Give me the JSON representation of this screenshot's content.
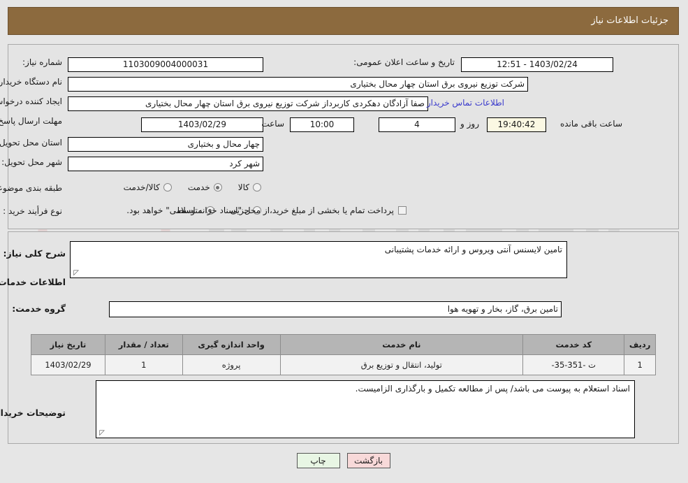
{
  "header": {
    "title": "جزئیات اطلاعات نیاز"
  },
  "colors": {
    "header_bg": "#8c6a3e",
    "page_bg": "#e6e6e6",
    "panel_bg": "#e4e4e4",
    "link": "#3b3bcc",
    "print_btn_bg": "#e8f6e4",
    "back_btn_bg": "#f8d9d9",
    "countdown_bg": "#fbf8e3"
  },
  "form": {
    "need_number_label": "شماره نیاز:",
    "need_number_value": "1103009004000031",
    "announce_datetime_label": "تاریخ و ساعت اعلان عمومی:",
    "announce_datetime_value": "1403/02/24 - 12:51",
    "buyer_org_label": "نام دستگاه خریدار:",
    "buyer_org_value": "شرکت توزیع نیروی برق استان چهار محال بختیاری",
    "creator_label": "ایجاد کننده درخواست:",
    "creator_value": "صفا آزادگان دهکردی کاربرداز شرکت توزیع نیروی برق استان چهار محال بختیاری",
    "buyer_contact_link": "اطلاعات تماس خریدار",
    "deadline_label": "مهلت ارسال پاسخ: تا تاریخ:",
    "deadline_date": "1403/02/29",
    "deadline_time_label": "ساعت",
    "deadline_time": "10:00",
    "remaining_days": "4",
    "remaining_days_label": "روز و",
    "remaining_clock": "19:40:42",
    "remaining_clock_label": "ساعت باقی مانده",
    "province_label": "استان محل تحویل:",
    "province_value": "چهار محال و بختیاری",
    "city_label": "شهر محل تحویل:",
    "city_value": "شهر کرد",
    "category_label": "طبقه بندی موضوعی:",
    "category_options": [
      {
        "label": "کالا",
        "selected": false
      },
      {
        "label": "خدمت",
        "selected": true
      },
      {
        "label": "کالا/خدمت",
        "selected": false
      }
    ],
    "process_label": "نوع فرأیند خرید :",
    "process_options": [
      {
        "label": "جزیی",
        "selected": false
      },
      {
        "label": "متوسط",
        "selected": true
      }
    ],
    "treasury_note": "پرداخت تمام یا بخشی از مبلغ خرید،از محل \"اسناد خزانه اسلامی\" خواهد بود.",
    "treasury_checked": false
  },
  "middle": {
    "general_desc_label": "شرح کلی نیاز:",
    "general_desc_value": "تامین لایسنس آنتی ویروس و ارائه خدمات پشتیبانی",
    "services_section_title": "اطلاعات خدمات مورد نیاز",
    "service_group_label": "گروه خدمت:",
    "service_group_value": "تامین برق، گاز، بخار و تهویه هوا",
    "buyer_notes_label": "توضیحات خریدار:",
    "buyer_notes_value": "اسناد استعلام به پیوست می باشد/ پس از مطالعه تکمیل و بارگذاری الزامیست."
  },
  "table": {
    "columns": [
      "ردیف",
      "کد خدمت",
      "نام خدمت",
      "واحد اندازه گیری",
      "تعداد / مقدار",
      "تاریخ نیاز"
    ],
    "rows": [
      {
        "index": "1",
        "service_code": "ت -351-35-",
        "service_name": "تولید، انتقال و توزیع برق",
        "unit": "پروژه",
        "quantity": "1",
        "need_date": "1403/02/29"
      }
    ]
  },
  "buttons": {
    "print": "چاپ",
    "back": "بازگشت"
  }
}
